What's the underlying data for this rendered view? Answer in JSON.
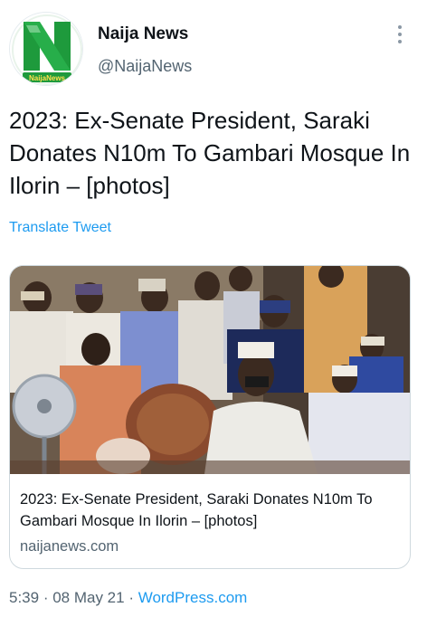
{
  "author": {
    "display_name": "Naija News",
    "handle": "@NaijaNews",
    "avatar_label": "NaijaNews",
    "menu_icon": "more-vertical-icon"
  },
  "tweet": {
    "text": "2023: Ex-Senate President, Saraki Donates N10m To Gambari Mosque In Ilorin – [photos]",
    "translate_label": "Translate Tweet"
  },
  "card": {
    "title": "2023: Ex-Senate President, Saraki Donates N10m To Gambari Mosque In Ilorin – [photos]",
    "domain": "naijanews.com"
  },
  "meta": {
    "time": "5:39",
    "separator1": " · ",
    "date": "08 May 21",
    "separator2": " · ",
    "source": "WordPress.com"
  },
  "colors": {
    "link": "#1d9bf0",
    "secondary_text": "#536471",
    "brand_green": "#1e9a3c"
  }
}
